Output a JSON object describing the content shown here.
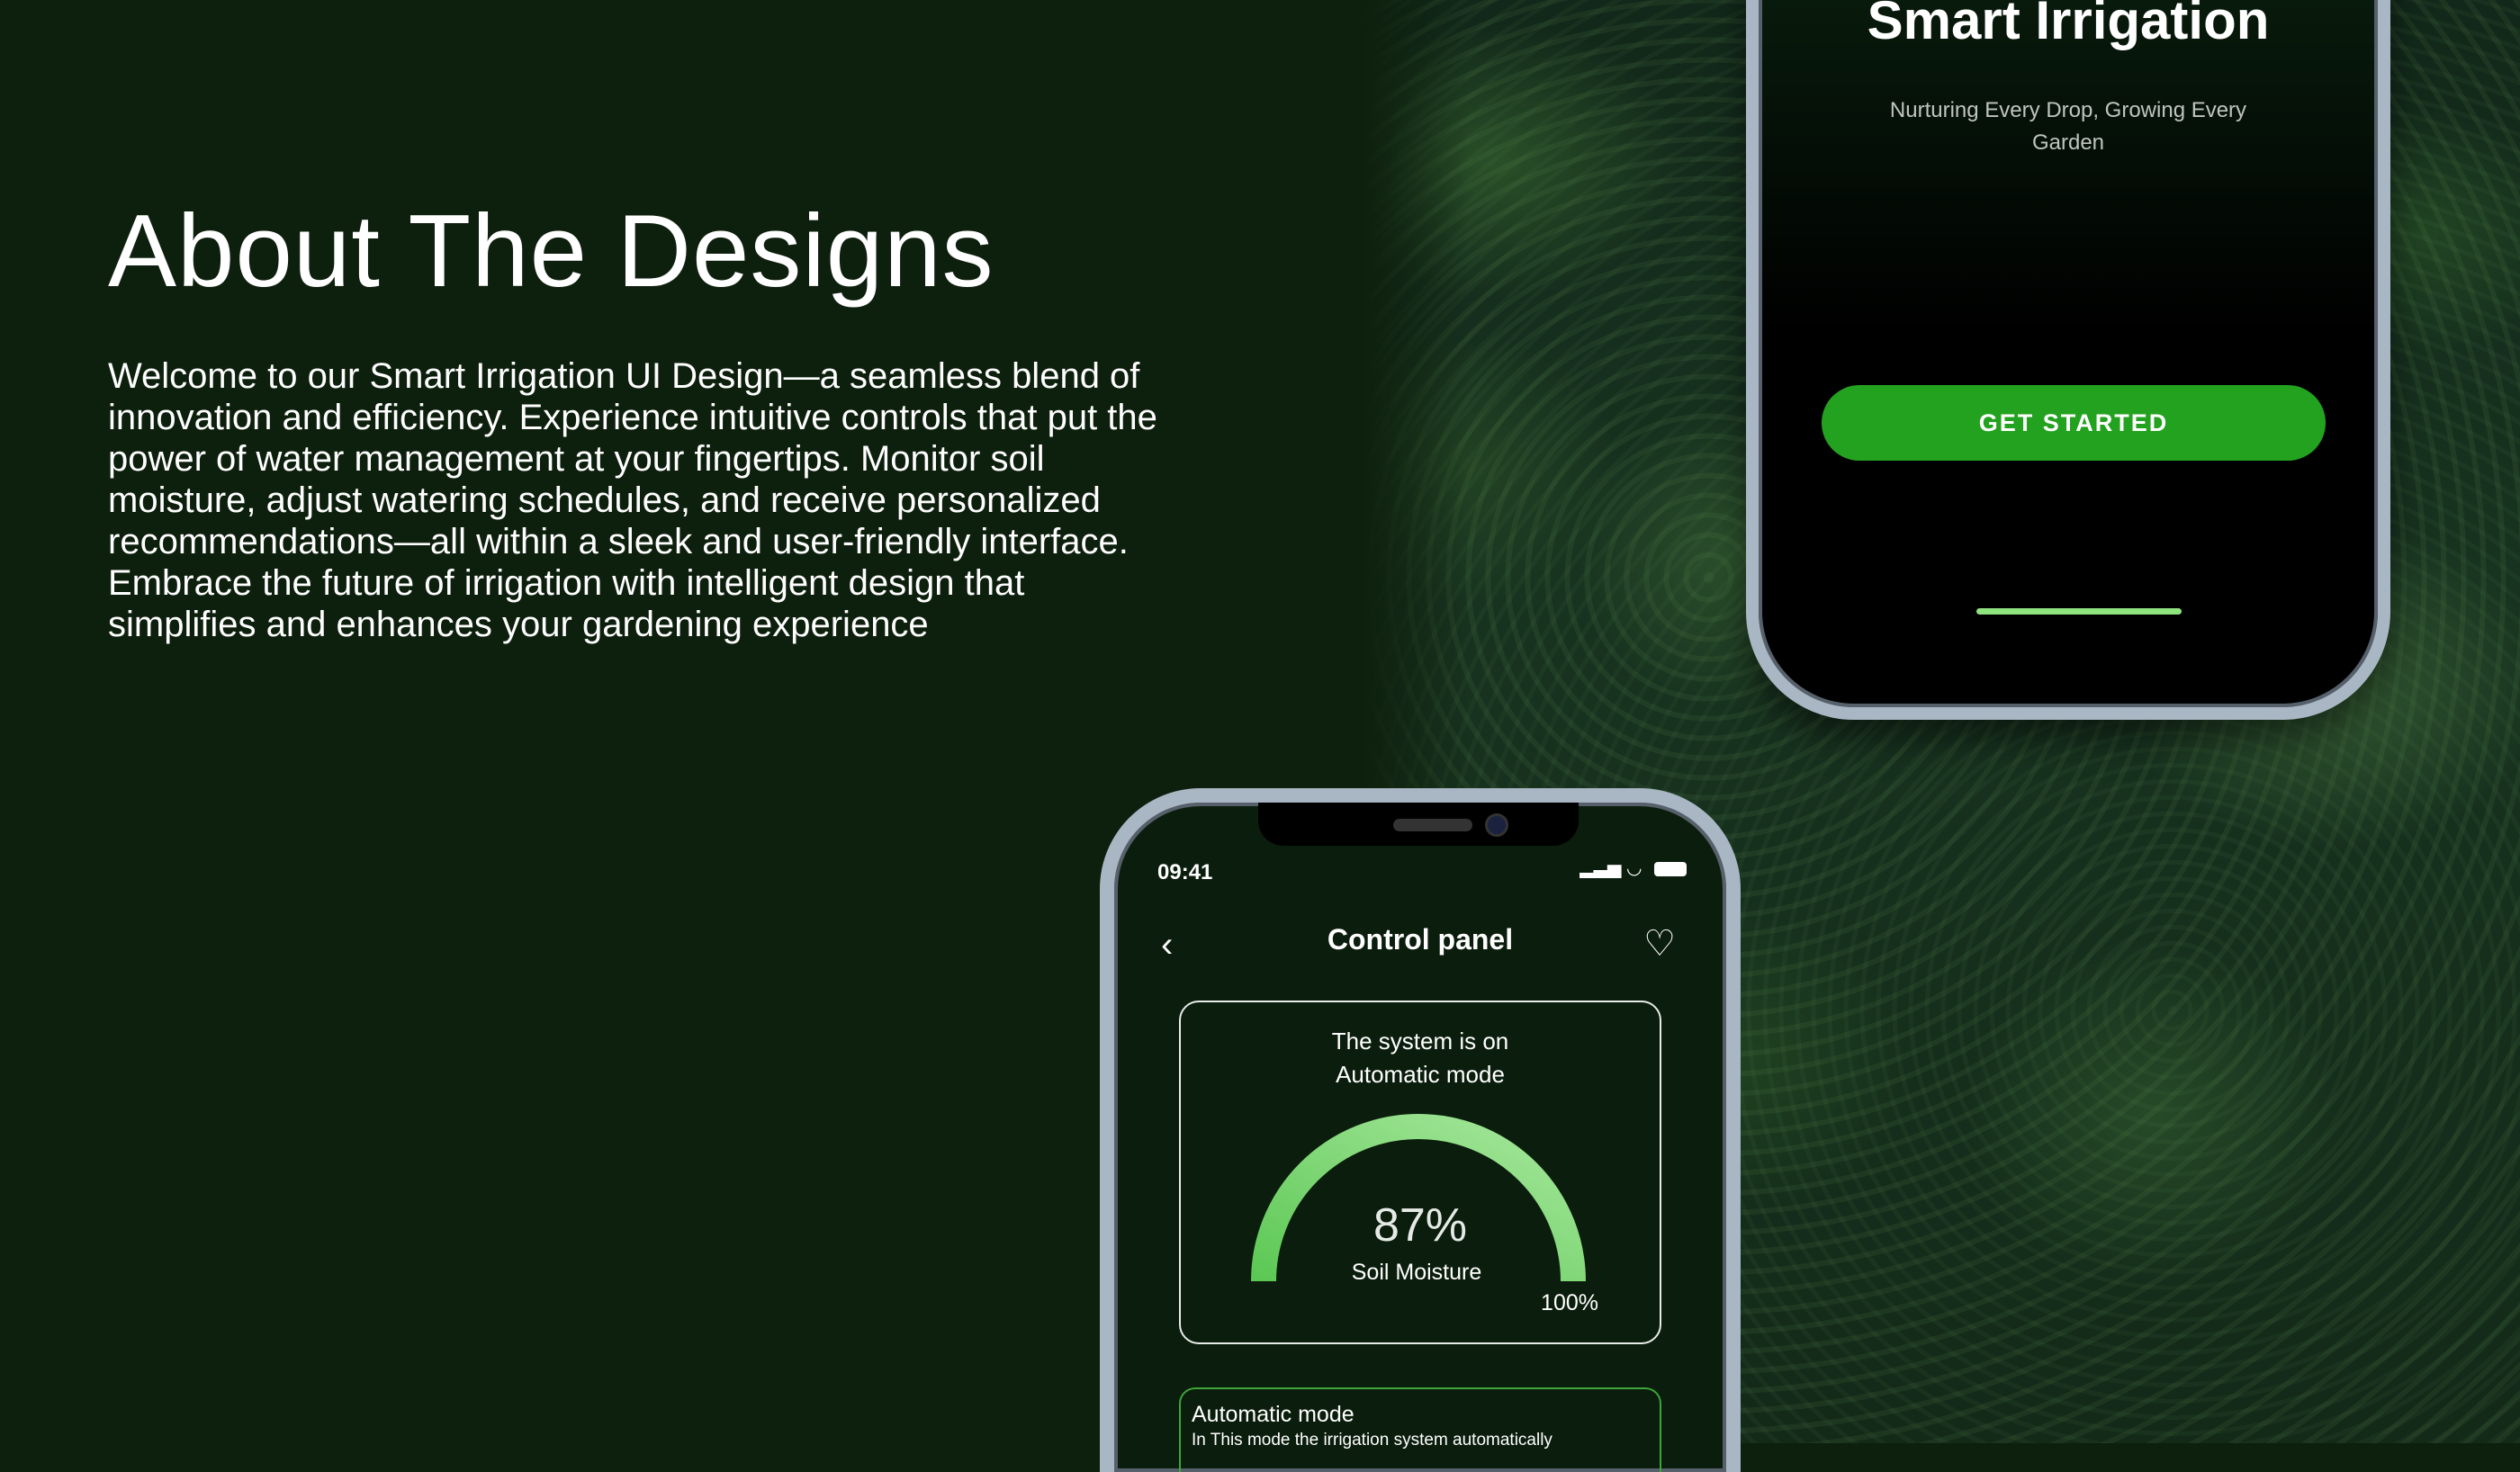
{
  "about": {
    "title": "About The Designs",
    "body": "Welcome to our Smart Irrigation UI Design—a seamless blend of innovation and efficiency. Experience intuitive controls that put the power of water management at your fingertips. Monitor soil moisture, adjust watering schedules, and receive personalized recommendations—all within a sleek and user-friendly interface. Embrace the future of irrigation with intelligent design that simplifies and enhances your gardening experience"
  },
  "phone1": {
    "title": "Smart Irrigation",
    "subtitle": "Nurturing Every Drop, Growing Every Garden",
    "button": "GET STARTED"
  },
  "phone2": {
    "status_time": "09:41",
    "nav_title": "Control panel",
    "icons": {
      "back": "chevron-left-icon",
      "favorite": "heart-icon",
      "signal": "signal-icon",
      "wifi": "wifi-icon",
      "battery": "battery-icon"
    },
    "status_card": {
      "line1": "The system is on",
      "line2": "Automatic  mode",
      "gauge_value": "87%",
      "gauge_fraction": 0.87,
      "gauge_label": "Soil Moisture",
      "gauge_max": "100%"
    },
    "mode_card": {
      "title": "Automatic mode",
      "description": "In This mode the irrigation system automatically"
    }
  },
  "colors": {
    "background": "#0d1f0d",
    "accent_green": "#23a21f",
    "gauge_light": "#a6e79c",
    "gauge_dark": "#5cc854"
  }
}
